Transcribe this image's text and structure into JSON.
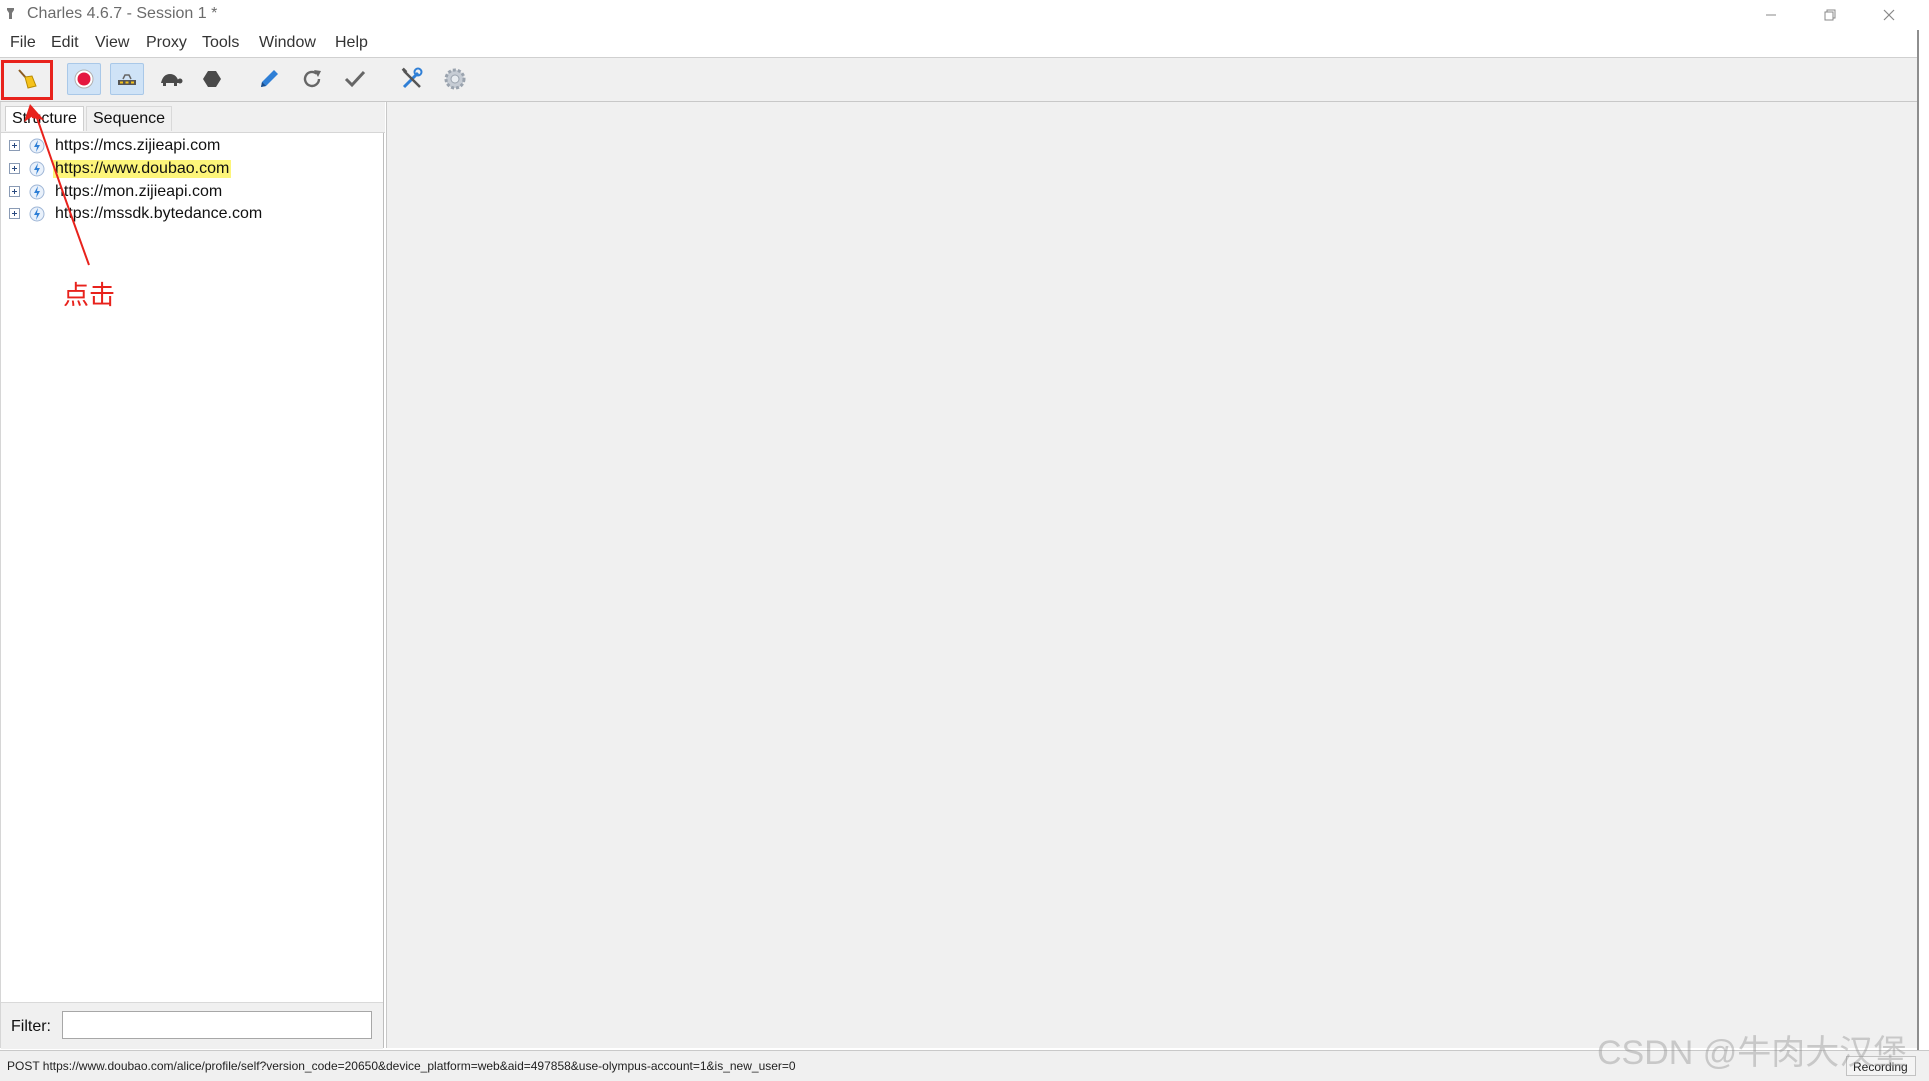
{
  "window": {
    "title": "Charles 4.6.7 - Session 1 *",
    "minimize_glyph": "—",
    "maximize_glyph": "❐",
    "close_glyph": "✕"
  },
  "menu": [
    "File",
    "Edit",
    "View",
    "Proxy",
    "Tools",
    "Window",
    "Help"
  ],
  "toolbar": {
    "buttons": [
      {
        "name": "clear-session-button",
        "icon": "broom-icon"
      },
      {
        "name": "start-recording-button",
        "icon": "record-icon",
        "active": true
      },
      {
        "name": "throttling-button",
        "icon": "throttle-icon",
        "active": true
      },
      {
        "name": "breakpoints-button",
        "icon": "turtle-icon"
      },
      {
        "name": "stop-button",
        "icon": "hexagon-icon"
      },
      {
        "name": "compose-button",
        "icon": "pen-icon"
      },
      {
        "name": "repeat-button",
        "icon": "refresh-icon"
      },
      {
        "name": "validate-button",
        "icon": "check-icon"
      },
      {
        "name": "tools-button",
        "icon": "tools-icon"
      },
      {
        "name": "settings-button",
        "icon": "gear-icon"
      }
    ],
    "colors": {
      "highlight": "#e8221c",
      "record": "#e5173f"
    }
  },
  "tabs": {
    "structure": "Structure",
    "sequence": "Sequence"
  },
  "tree": [
    {
      "label": "https://mcs.zijieapi.com",
      "highlighted": false
    },
    {
      "label": "https://www.doubao.com",
      "highlighted": true
    },
    {
      "label": "https://mon.zijieapi.com",
      "highlighted": false
    },
    {
      "label": "https://mssdk.bytedance.com",
      "highlighted": false
    }
  ],
  "filter": {
    "label": "Filter:",
    "value": ""
  },
  "status": {
    "text": "POST https://www.doubao.com/alice/profile/self?version_code=20650&device_platform=web&aid=497858&use-olympus-account=1&is_new_user=0",
    "recording": "Recording"
  },
  "annotation": {
    "text": "点击"
  },
  "watermark": "CSDN @牛肉大汉堡"
}
